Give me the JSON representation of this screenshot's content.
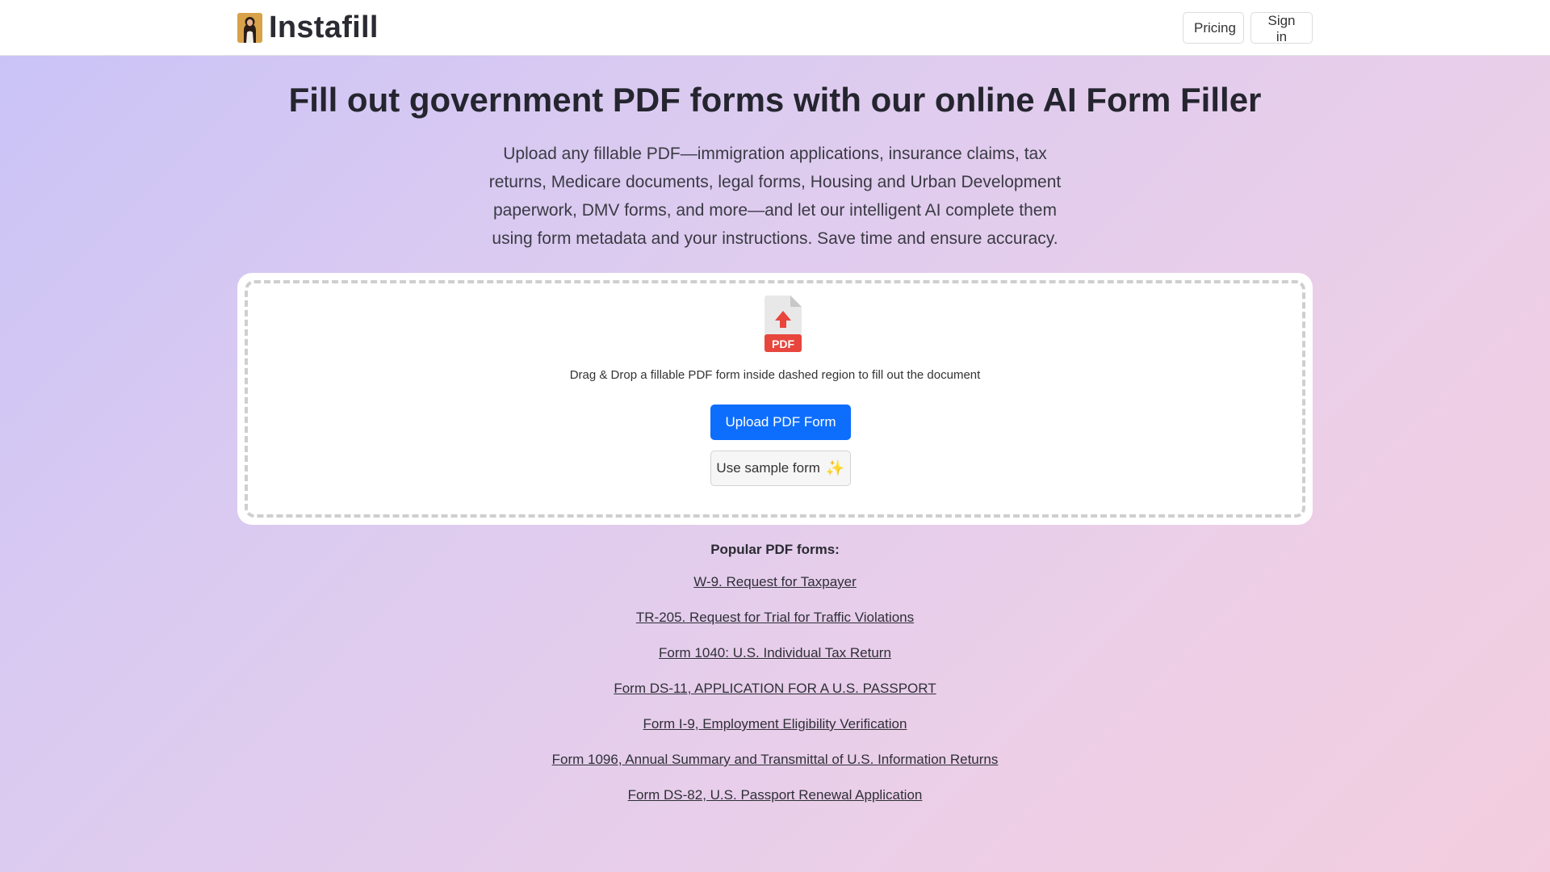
{
  "navbar": {
    "brand_name": "Instafill",
    "pricing_label": "Pricing",
    "signin_label": "Sign in"
  },
  "hero": {
    "title": "Fill out government PDF forms with our online AI Form Filler",
    "description": "Upload any fillable PDF—immigration applications, insurance claims, tax returns, Medicare documents, legal forms, Housing and Urban Development paperwork, DMV forms, and more—and let our intelligent AI complete them using form metadata and your instructions. Save time and ensure accuracy."
  },
  "upload": {
    "icon_label": "PDF",
    "drop_text": "Drag & Drop a fillable PDF form inside dashed region to fill out the document",
    "upload_button": "Upload PDF Form",
    "sample_button": "Use sample form",
    "sample_icon": "sparkle-icon"
  },
  "popular": {
    "title": "Popular PDF forms:",
    "forms": [
      "W-9. Request for Taxpayer",
      "TR-205. Request for Trial for Traffic Violations",
      "Form 1040: U.S. Individual Tax Return",
      "Form DS-11, APPLICATION FOR A U.S. PASSPORT",
      "Form I-9, Employment Eligibility Verification",
      "Form 1096, Annual Summary and Transmittal of U.S. Information Returns",
      "Form DS-82, U.S. Passport Renewal Application"
    ]
  },
  "colors": {
    "primary_button": "#0d6efd",
    "pdf_red": "#e8453c",
    "gradient_start": "#c9c3f7",
    "gradient_end": "#f3cddf"
  }
}
